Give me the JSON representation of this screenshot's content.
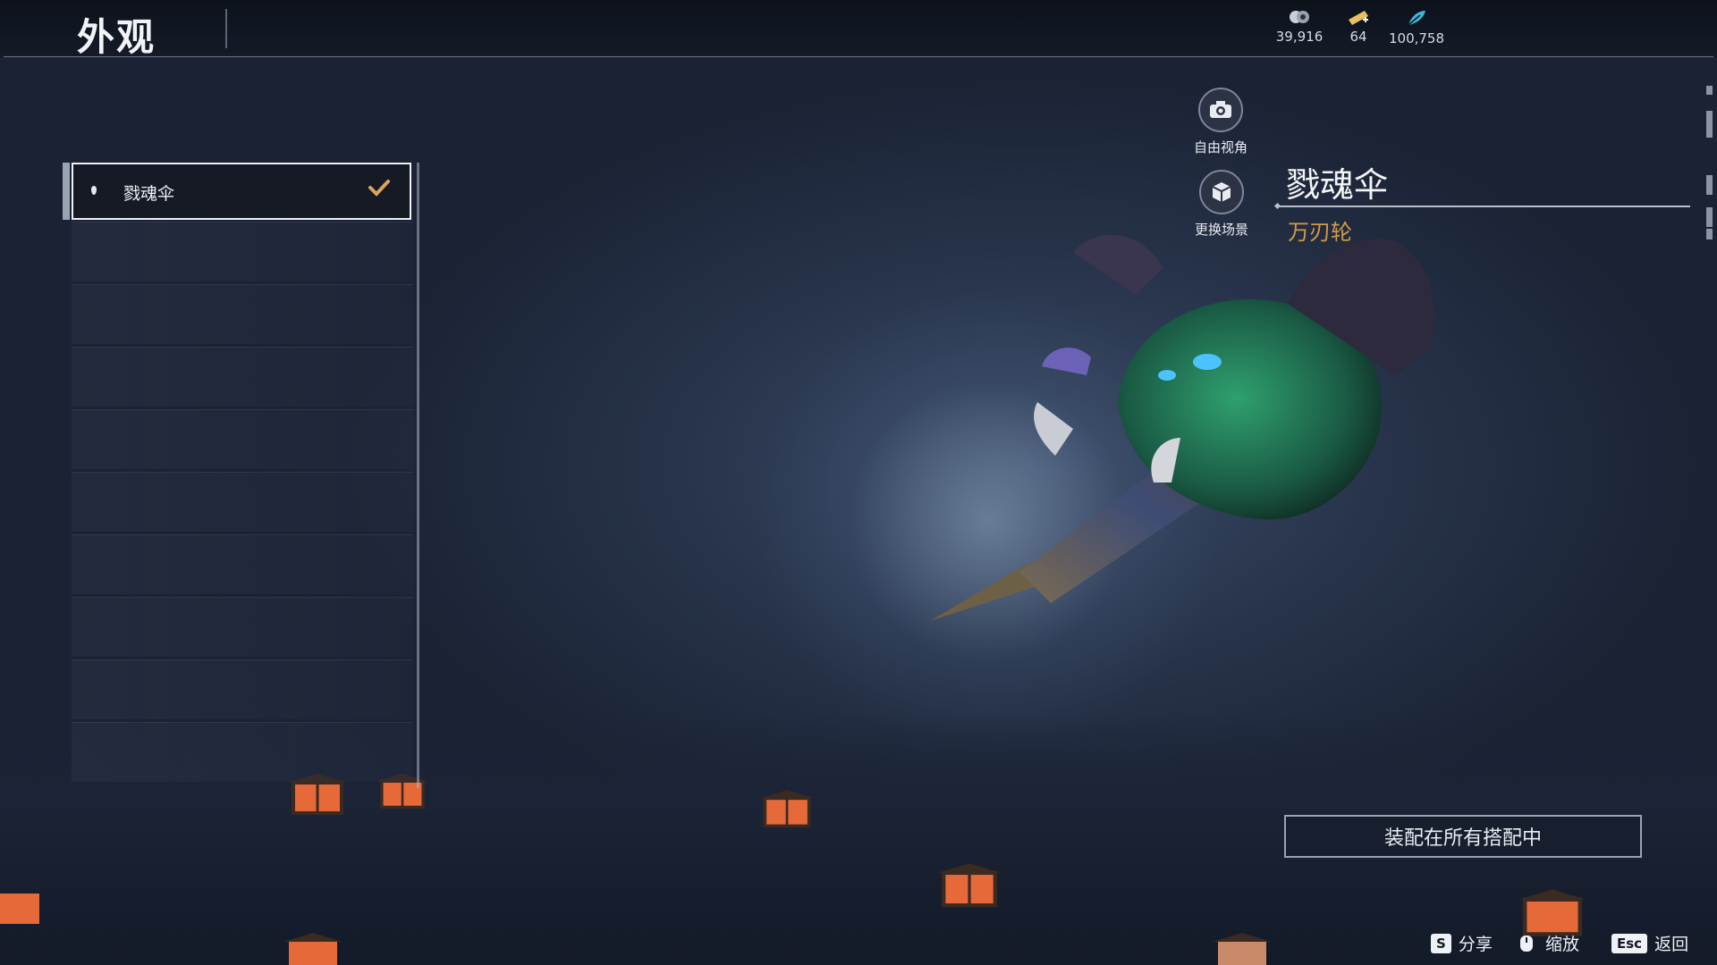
{
  "header": {
    "title": "外观"
  },
  "currencies": [
    {
      "icon": "coin-icon",
      "amount": "39,916"
    },
    {
      "icon": "ticket-icon",
      "amount": "64"
    },
    {
      "icon": "feather-icon",
      "amount": "100,758"
    }
  ],
  "skin_list": {
    "items": [
      {
        "label": "戮魂伞",
        "selected": true,
        "equipped": true
      }
    ]
  },
  "view_controls": {
    "free_view_label": "自由视角",
    "change_scene_label": "更换场景"
  },
  "item": {
    "name": "戮魂伞",
    "type": "万刃轮"
  },
  "equip_button_label": "装配在所有搭配中",
  "hints": [
    {
      "key": "S",
      "label": "分享"
    },
    {
      "key": "mouse-icon",
      "label": "缩放"
    },
    {
      "key": "Esc",
      "label": "返回"
    }
  ],
  "colors": {
    "accent_gold": "#d29a4a",
    "checkmark": "#e0a25a"
  }
}
